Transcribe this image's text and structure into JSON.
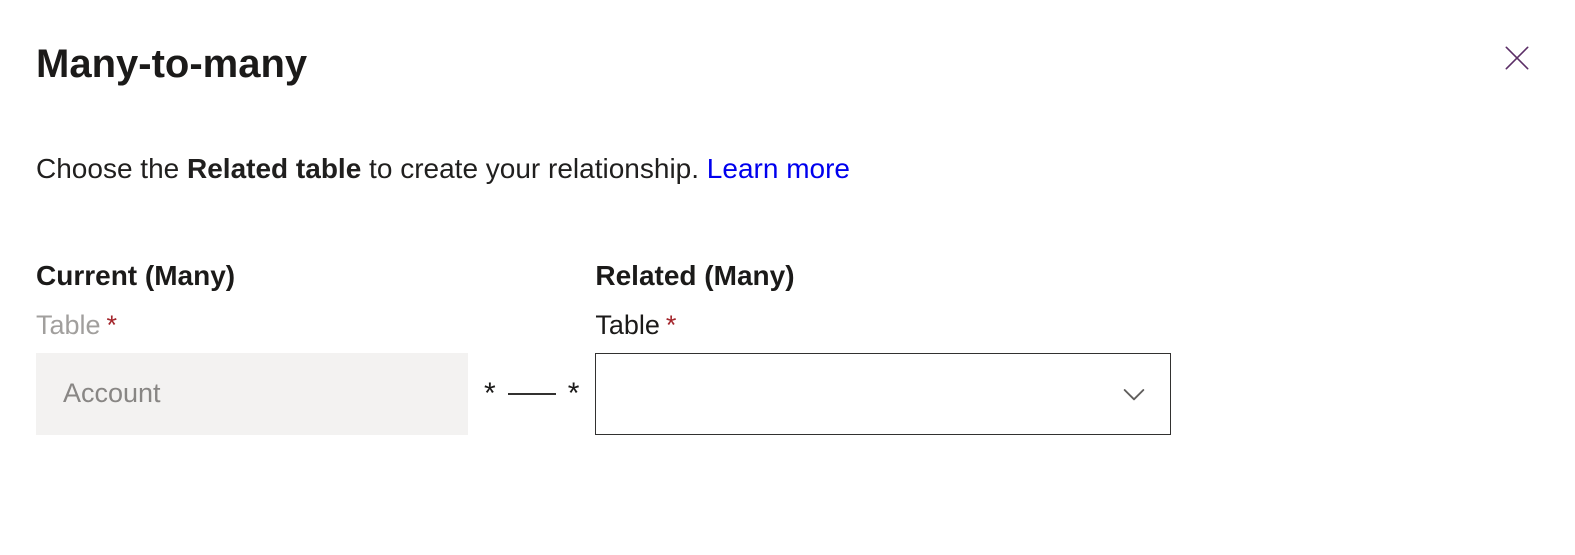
{
  "title": "Many-to-many",
  "description": {
    "prefix": "Choose the ",
    "bold": "Related table",
    "suffix": " to create your relationship. ",
    "link": "Learn more"
  },
  "connector": {
    "left": "*",
    "right": "*"
  },
  "current": {
    "heading": "Current (Many)",
    "label": "Table",
    "required": "*",
    "value": "Account"
  },
  "related": {
    "heading": "Related (Many)",
    "label": "Table",
    "required": "*",
    "value": ""
  }
}
